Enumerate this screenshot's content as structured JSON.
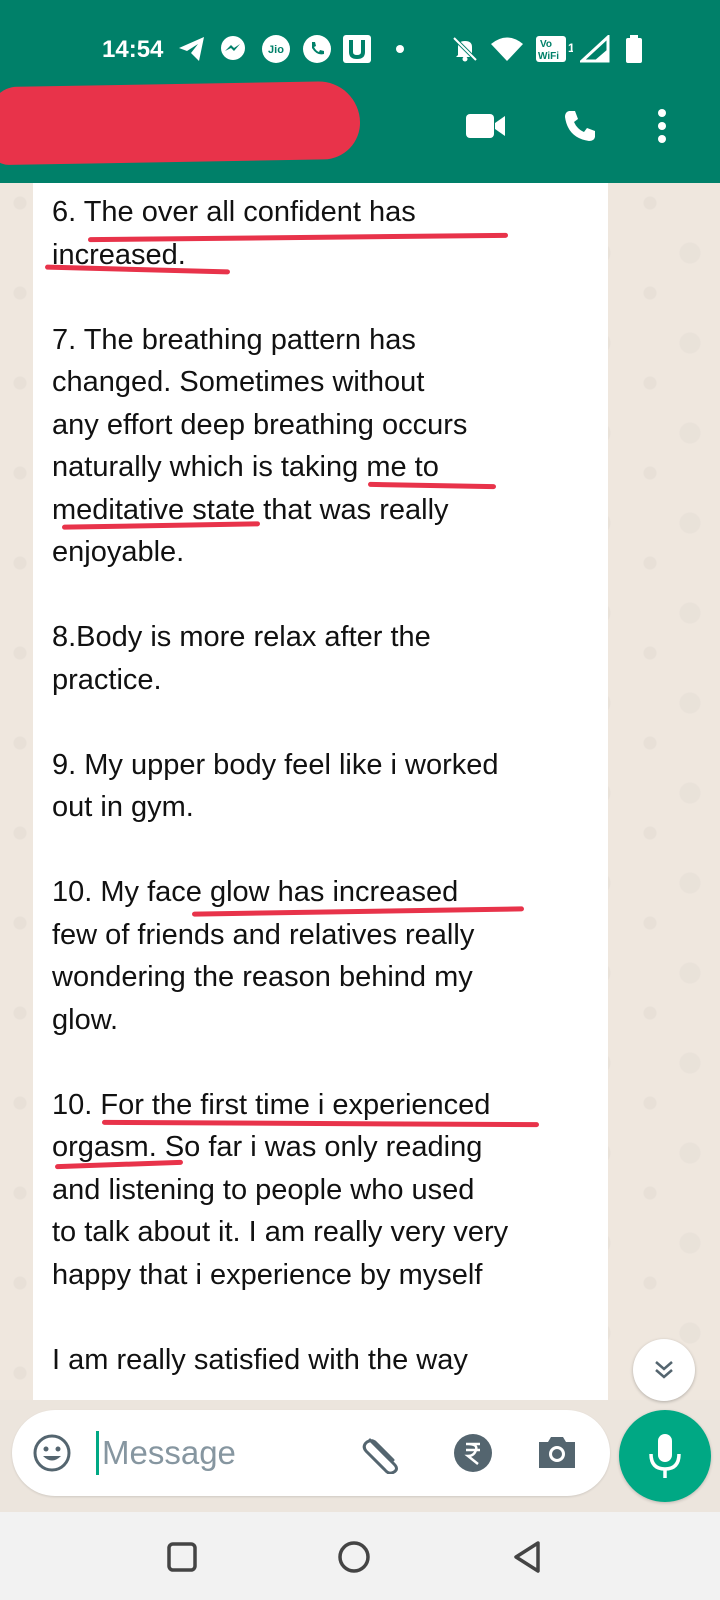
{
  "status_bar": {
    "time": "14:54",
    "carrier_badge": "Jio",
    "wifi_badge_top": "Vo",
    "wifi_badge_bottom": "WiFi",
    "wifi_badge_num": "1"
  },
  "header_icons": [
    "video-call-icon",
    "voice-call-icon",
    "more-options-icon"
  ],
  "message_lines": [
    "6. The over all confident has",
    "increased.",
    "",
    "7. The breathing pattern has",
    "changed. Sometimes without",
    "any effort deep breathing occurs",
    "naturally which is taking me to",
    "meditative state that was really",
    "enjoyable.",
    "",
    "8.Body is more relax after the",
    "practice.",
    "",
    "9. My upper body  feel like i worked",
    "out in gym.",
    "",
    "10. My face glow has increased",
    "few of friends and relatives really",
    "wondering the reason behind my",
    "glow.",
    "",
    "10. For the first time i experienced",
    "orgasm. So far i was only reading",
    "and listening to people who used",
    "to talk about it. I am really very very",
    "happy that i experience by myself",
    "",
    "I am really satisfied with the way"
  ],
  "composer": {
    "placeholder": "Message"
  },
  "colors": {
    "header": "#008069",
    "accent": "#00a884",
    "annotation": "#e8334a"
  }
}
